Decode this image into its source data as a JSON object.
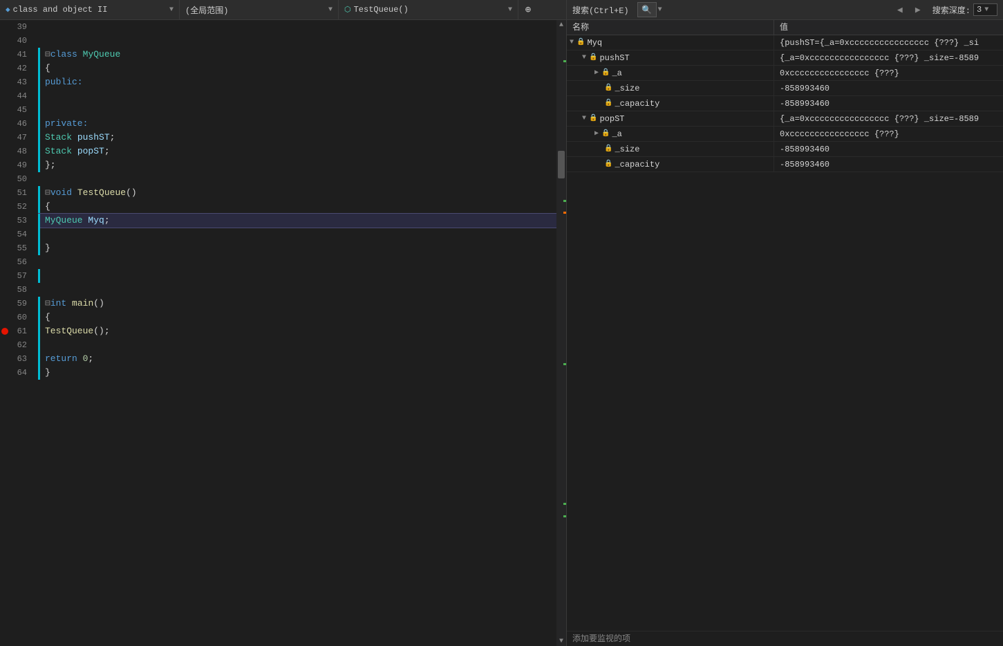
{
  "toolbar": {
    "file_label": "class and object II",
    "file_icon": "◆",
    "scope_label": "(全局范围)",
    "func_label": "TestQueue()",
    "func_icon": "⬡",
    "plus_icon": "⊕",
    "search_label": "搜索(Ctrl+E)",
    "nav_back": "◀",
    "nav_fwd": "▶",
    "depth_label": "搜索深度:",
    "depth_value": "3",
    "dropdown_arrow": "▼"
  },
  "watch": {
    "col_name": "名称",
    "col_value": "值",
    "add_label": "添加要监视的项",
    "rows": [
      {
        "id": "myq",
        "indent": 0,
        "expanded": true,
        "has_expand": true,
        "expand_char": "▼",
        "icon": "lock",
        "name": "Myq",
        "value": "{pushST={_a=0xcccccccccccccccc {???} _si"
      },
      {
        "id": "pushst",
        "indent": 1,
        "expanded": true,
        "has_expand": true,
        "expand_char": "▼",
        "icon": "lock",
        "name": "pushST",
        "value": "{_a=0xcccccccccccccccc {???} _size=-8589"
      },
      {
        "id": "pushst-a",
        "indent": 2,
        "expanded": false,
        "has_expand": true,
        "expand_char": "▶",
        "icon": "lock",
        "name": "_a",
        "value": "0xcccccccccccccccc {???}"
      },
      {
        "id": "pushst-size",
        "indent": 2,
        "expanded": false,
        "has_expand": false,
        "expand_char": "",
        "icon": "lock",
        "name": "_size",
        "value": "-858993460"
      },
      {
        "id": "pushst-capacity",
        "indent": 2,
        "expanded": false,
        "has_expand": false,
        "expand_char": "",
        "icon": "lock",
        "name": "_capacity",
        "value": "-858993460"
      },
      {
        "id": "popst",
        "indent": 1,
        "expanded": true,
        "has_expand": true,
        "expand_char": "▼",
        "icon": "lock",
        "name": "popST",
        "value": "{_a=0xcccccccccccccccc {???} _size=-8589"
      },
      {
        "id": "popst-a",
        "indent": 2,
        "expanded": false,
        "has_expand": true,
        "expand_char": "▶",
        "icon": "lock",
        "name": "_a",
        "value": "0xcccccccccccccccc {???}"
      },
      {
        "id": "popst-size",
        "indent": 2,
        "expanded": false,
        "has_expand": false,
        "expand_char": "",
        "icon": "lock",
        "name": "_size",
        "value": "-858993460"
      },
      {
        "id": "popst-capacity",
        "indent": 2,
        "expanded": false,
        "has_expand": false,
        "expand_char": "",
        "icon": "lock",
        "name": "_capacity",
        "value": "-858993460"
      }
    ]
  },
  "code": {
    "lines": [
      {
        "num": 39,
        "content": "",
        "tokens": []
      },
      {
        "num": 40,
        "content": "",
        "tokens": []
      },
      {
        "num": 41,
        "content": "⊟class MyQueue",
        "has_bar": true,
        "tokens": [
          {
            "t": "collapse",
            "v": "⊟"
          },
          {
            "t": "kw",
            "v": "class "
          },
          {
            "t": "class-name",
            "v": "MyQueue"
          }
        ]
      },
      {
        "num": 42,
        "content": "{",
        "has_bar": true,
        "tokens": [
          {
            "t": "punct",
            "v": "{"
          }
        ]
      },
      {
        "num": 43,
        "content": "    public:",
        "has_bar": true,
        "tokens": [
          {
            "t": "kw",
            "v": "public:"
          }
        ]
      },
      {
        "num": 44,
        "content": "",
        "has_bar": true,
        "tokens": []
      },
      {
        "num": 45,
        "content": "",
        "has_bar": true,
        "tokens": []
      },
      {
        "num": 46,
        "content": "    private:",
        "has_bar": true,
        "tokens": [
          {
            "t": "kw",
            "v": "private:"
          }
        ]
      },
      {
        "num": 47,
        "content": "        Stack pushST;",
        "has_bar": true,
        "tokens": [
          {
            "t": "type",
            "v": "Stack "
          },
          {
            "t": "var",
            "v": "pushST"
          },
          {
            "t": "punct",
            "v": ";"
          }
        ]
      },
      {
        "num": 48,
        "content": "        Stack popST;",
        "has_bar": true,
        "tokens": [
          {
            "t": "type",
            "v": "Stack "
          },
          {
            "t": "var",
            "v": "popST"
          },
          {
            "t": "punct",
            "v": ";"
          }
        ]
      },
      {
        "num": 49,
        "content": "};",
        "has_bar": true,
        "tokens": [
          {
            "t": "punct",
            "v": "};"
          }
        ]
      },
      {
        "num": 50,
        "content": "",
        "tokens": []
      },
      {
        "num": 51,
        "content": "⊟void TestQueue()",
        "has_bar": true,
        "tokens": [
          {
            "t": "collapse",
            "v": "⊟"
          },
          {
            "t": "kw",
            "v": "void "
          },
          {
            "t": "func-name",
            "v": "TestQueue"
          },
          {
            "t": "punct",
            "v": "()"
          }
        ]
      },
      {
        "num": 52,
        "content": "{",
        "has_bar": true,
        "tokens": [
          {
            "t": "punct",
            "v": "{"
          }
        ]
      },
      {
        "num": 53,
        "content": "    MyQueue Myq;",
        "has_bar": true,
        "active": true,
        "tokens": [
          {
            "t": "type",
            "v": "MyQueue "
          },
          {
            "t": "var",
            "v": "Myq"
          },
          {
            "t": "punct",
            "v": ";"
          }
        ]
      },
      {
        "num": 54,
        "content": "",
        "has_bar": true,
        "tokens": []
      },
      {
        "num": 55,
        "content": "}",
        "has_bar": true,
        "tokens": [
          {
            "t": "punct",
            "v": "}"
          }
        ]
      },
      {
        "num": 56,
        "content": "",
        "tokens": []
      },
      {
        "num": 57,
        "content": "",
        "has_bar": true,
        "tokens": []
      },
      {
        "num": 58,
        "content": "",
        "tokens": []
      },
      {
        "num": 59,
        "content": "⊟int main()",
        "has_bar": true,
        "tokens": [
          {
            "t": "collapse",
            "v": "⊟"
          },
          {
            "t": "kw",
            "v": "int "
          },
          {
            "t": "func-name",
            "v": "main"
          },
          {
            "t": "punct",
            "v": "()"
          }
        ]
      },
      {
        "num": 60,
        "content": "{",
        "has_bar": true,
        "tokens": [
          {
            "t": "punct",
            "v": "{"
          }
        ]
      },
      {
        "num": 61,
        "content": "    TestQueue();",
        "has_bar": true,
        "has_breakpoint": true,
        "tokens": [
          {
            "t": "func-name",
            "v": "TestQueue"
          },
          {
            "t": "punct",
            "v": "();"
          }
        ]
      },
      {
        "num": 62,
        "content": "",
        "has_bar": true,
        "tokens": []
      },
      {
        "num": 63,
        "content": "    return 0;",
        "has_bar": true,
        "tokens": [
          {
            "t": "kw",
            "v": "return "
          },
          {
            "t": "number",
            "v": "0"
          },
          {
            "t": "punct",
            "v": ";"
          }
        ]
      },
      {
        "num": 64,
        "content": "}",
        "has_bar": true,
        "tokens": [
          {
            "t": "punct",
            "v": "}"
          }
        ]
      }
    ]
  }
}
